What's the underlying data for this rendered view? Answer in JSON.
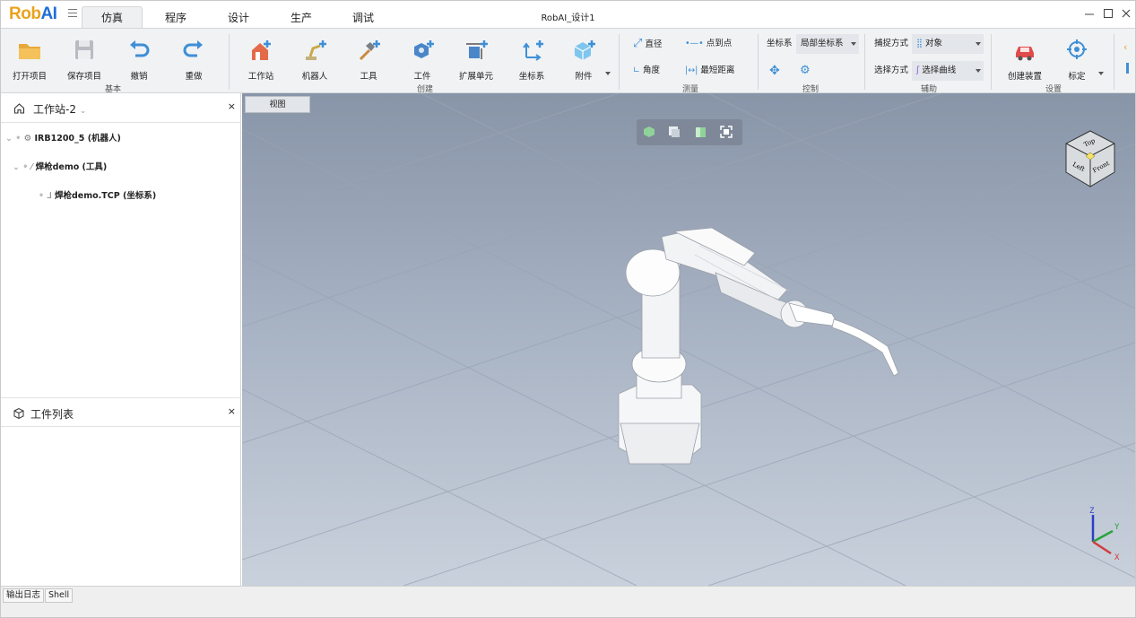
{
  "app": {
    "logo_part1": "Rob",
    "logo_part2": "AI",
    "window_title": "RobAI_设计1"
  },
  "tabs": [
    {
      "label": "仿真",
      "active": true
    },
    {
      "label": "程序"
    },
    {
      "label": "设计"
    },
    {
      "label": "生产"
    },
    {
      "label": "调试"
    }
  ],
  "ribbon": {
    "basic": {
      "group": "基本",
      "open": "打开项目",
      "save": "保存项目",
      "undo": "撤销",
      "redo": "重做"
    },
    "create": {
      "group": "创建",
      "workstation": "工作站",
      "robot": "机器人",
      "tool": "工具",
      "workpiece": "工件",
      "extension": "扩展单元",
      "frame": "坐标系",
      "attachment": "附件"
    },
    "measure": {
      "group": "测量",
      "diameter": "直径",
      "point_to_point": "点到点",
      "angle": "角度",
      "shortest": "最短距离"
    },
    "control": {
      "group": "控制",
      "frame_label": "坐标系",
      "frame_value": "局部坐标系"
    },
    "assist": {
      "group": "辅助",
      "snap_label": "捕捉方式",
      "snap_value": "对象",
      "select_label": "选择方式",
      "select_value": "选择曲线"
    },
    "settings": {
      "group": "设置",
      "create_device": "创建装置",
      "calibrate": "标定"
    }
  },
  "left": {
    "station": {
      "title": "工作站-2"
    },
    "tree": [
      {
        "label": "IRB1200_5 (机器人)"
      },
      {
        "label": "焊枪demo (工具)"
      },
      {
        "label": "焊枪demo.TCP (坐标系)"
      }
    ],
    "parts": {
      "title": "工件列表"
    }
  },
  "viewport": {
    "tab": "视图",
    "cube_labels": {
      "top": "Top",
      "left": "Left",
      "front": "Front"
    },
    "axes": {
      "x": "X",
      "y": "Y",
      "z": "Z"
    }
  },
  "status": {
    "tabs": [
      "输出日志",
      "Shell"
    ]
  },
  "colors": {
    "logo_orange": "#e9a21e",
    "logo_blue": "#1e6fd8",
    "icon_blue": "#3f8fd6",
    "icon_red": "#e04a4a"
  }
}
